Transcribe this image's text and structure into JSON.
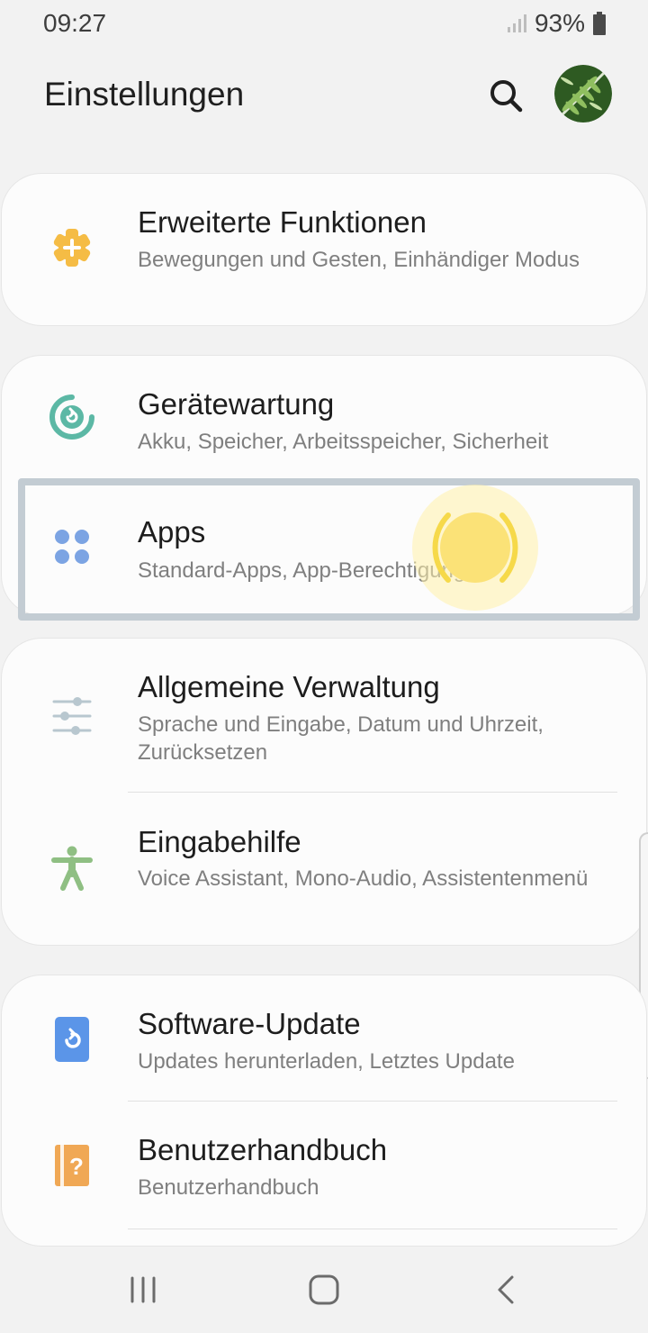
{
  "status_bar": {
    "time": "09:27",
    "battery_percent": "93%",
    "battery_level": 0.93
  },
  "header": {
    "title": "Einstellungen",
    "search_icon": "search-icon",
    "avatar": "profile-avatar"
  },
  "cards": [
    {
      "items": [
        {
          "title": "Erweiterte Funktionen",
          "subtitle": "Bewegungen und Gesten, Einhändiger Modus",
          "icon": "advanced-features-icon",
          "color": "#f5bc45"
        }
      ]
    },
    {
      "items": [
        {
          "title": "Gerätewartung",
          "subtitle": "Akku, Speicher, Arbeitsspeicher, Sicherheit",
          "icon": "device-care-icon",
          "color": "#5cb8a5"
        },
        {
          "title": "Apps",
          "subtitle": "Standard-Apps, App-Berechtigungen",
          "icon": "apps-icon",
          "color": "#7ca4e3"
        }
      ]
    },
    {
      "items": [
        {
          "title": "Allgemeine Verwaltung",
          "subtitle": "Sprache und Eingabe, Datum und Uhrzeit, Zurücksetzen",
          "icon": "general-management-icon",
          "color": "#b8c7cf"
        },
        {
          "title": "Eingabehilfe",
          "subtitle": "Voice Assistant, Mono-Audio, Assistentenmenü",
          "icon": "accessibility-icon",
          "color": "#8fbf83"
        }
      ]
    },
    {
      "items": [
        {
          "title": "Software-Update",
          "subtitle": "Updates herunterladen, Letztes Update",
          "icon": "software-update-icon",
          "color": "#5b95e8"
        },
        {
          "title": "Benutzerhandbuch",
          "subtitle": "Benutzerhandbuch",
          "icon": "user-manual-icon",
          "color": "#f0a855"
        }
      ]
    }
  ],
  "nav_bar": {
    "recents_icon": "recents-icon",
    "home_icon": "home-icon",
    "back_icon": "back-icon"
  }
}
